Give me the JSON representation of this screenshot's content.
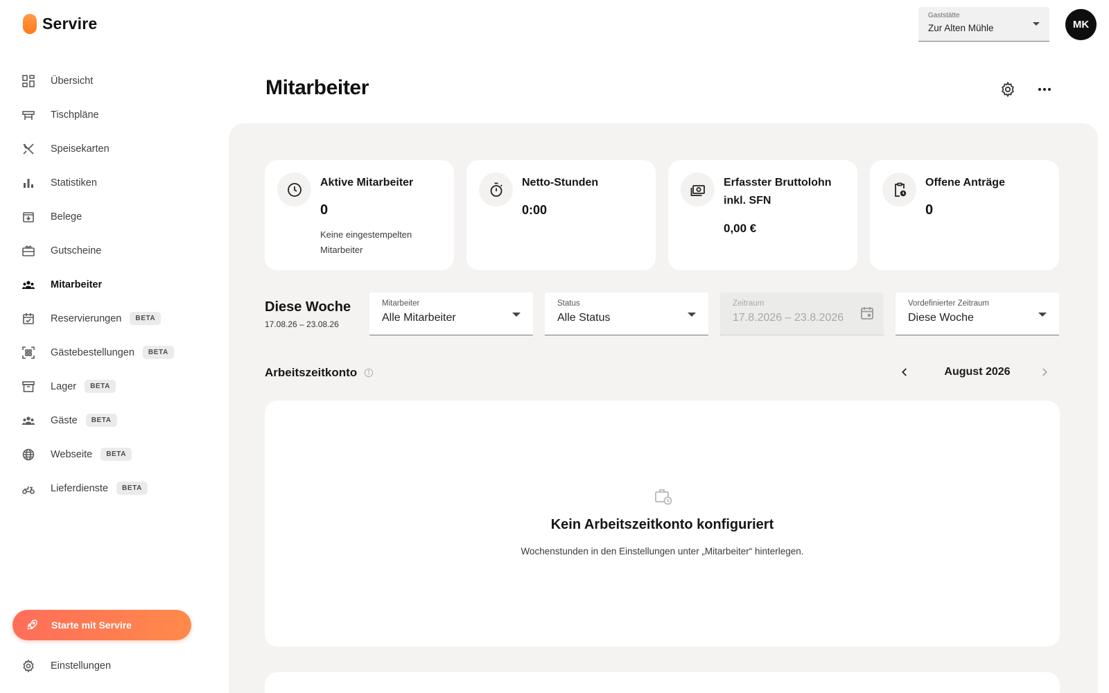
{
  "app": {
    "name": "Servire",
    "brand_color": "#ff8a3d"
  },
  "sidebar": {
    "items": [
      {
        "label": "Übersicht",
        "icon": "dashboard-icon",
        "beta": ""
      },
      {
        "label": "Tischpläne",
        "icon": "table-icon",
        "beta": ""
      },
      {
        "label": "Speisekarten",
        "icon": "cutlery-icon",
        "beta": ""
      },
      {
        "label": "Statistiken",
        "icon": "bar-chart-icon",
        "beta": ""
      },
      {
        "label": "Belege",
        "icon": "receipt-box-icon",
        "beta": ""
      },
      {
        "label": "Gutscheine",
        "icon": "gift-card-icon",
        "beta": ""
      },
      {
        "label": "Mitarbeiter",
        "icon": "people-icon",
        "beta": ""
      },
      {
        "label": "Reservierungen",
        "icon": "calendar-check-icon",
        "beta": "BETA"
      },
      {
        "label": "Gästebestellungen",
        "icon": "qr-code-icon",
        "beta": "BETA"
      },
      {
        "label": "Lager",
        "icon": "archive-box-icon",
        "beta": "BETA"
      },
      {
        "label": "Gäste",
        "icon": "guests-icon",
        "beta": "BETA"
      },
      {
        "label": "Webseite",
        "icon": "globe-icon",
        "beta": "BETA"
      },
      {
        "label": "Lieferdienste",
        "icon": "scooter-icon",
        "beta": "BETA"
      }
    ],
    "start_button": "Starte mit Servire",
    "settings": "Einstellungen"
  },
  "topbar": {
    "venue_label": "Gaststätte",
    "venue_value": "Zur Alten Mühle",
    "avatar_initials": "MK"
  },
  "header": {
    "title": "Mitarbeiter"
  },
  "stats": [
    {
      "title": "Aktive Mitarbeiter",
      "value": "0",
      "sub": "Keine eingestempelten Mitarbeiter",
      "icon": "clock-icon"
    },
    {
      "title": "Netto-Stunden",
      "value": "0:00",
      "sub": "",
      "icon": "stopwatch-icon"
    },
    {
      "title": "Erfasster Bruttolohn inkl. SFN",
      "value": "0,00 €",
      "sub": "",
      "icon": "money-icon"
    },
    {
      "title": "Offene Anträge",
      "value": "0",
      "sub": "",
      "icon": "clipboard-clock-icon"
    }
  ],
  "week": {
    "title": "Diese Woche",
    "range": "17.08.26 – 23.08.26"
  },
  "filters": {
    "employee": {
      "label": "Mitarbeiter",
      "value": "Alle Mitarbeiter"
    },
    "status": {
      "label": "Status",
      "value": "Alle Status"
    },
    "period": {
      "label": "Zeitraum",
      "value": "17.8.2026 – 23.8.2026"
    },
    "preset": {
      "label": "Vordefinierter Zeitraum",
      "value": "Diese Woche"
    }
  },
  "work_account": {
    "title": "Arbeitszeitkonto",
    "month": "August 2026",
    "empty_title": "Kein Arbeitszeitkonto konfiguriert",
    "empty_sub": "Wochenstunden in den Einstellungen unter „Mitarbeiter“ hinterlegen."
  }
}
